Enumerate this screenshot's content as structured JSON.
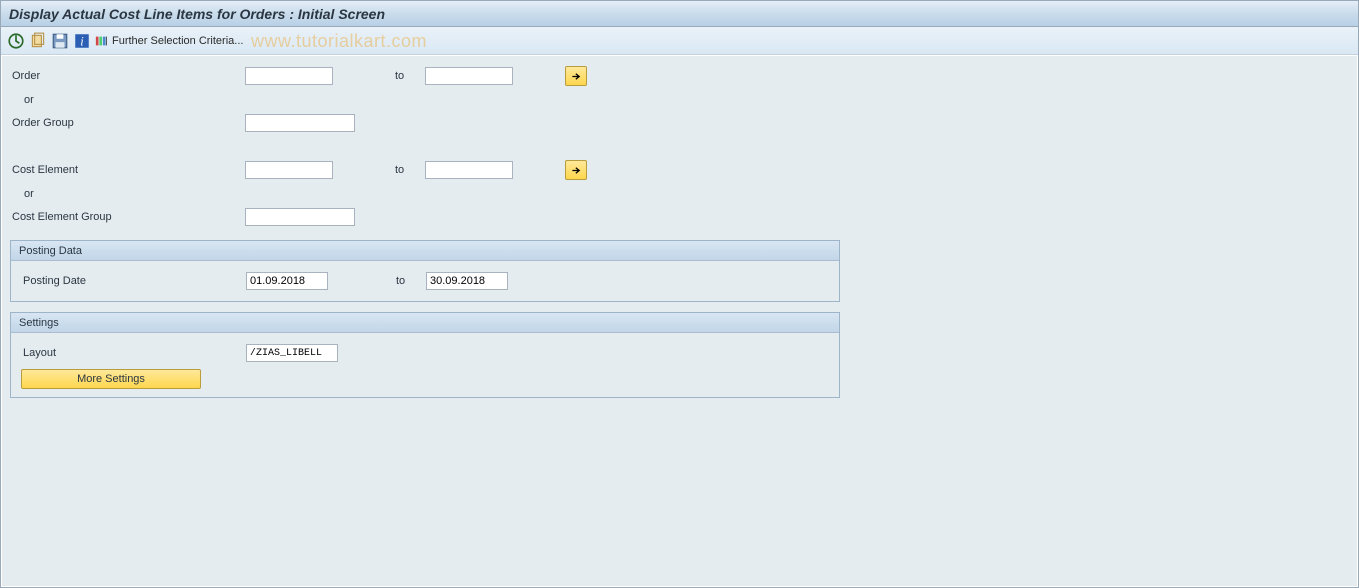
{
  "header": {
    "title": "Display Actual Cost Line Items for Orders : Initial Screen"
  },
  "toolbar": {
    "further_selection": "Further Selection Criteria..."
  },
  "watermark": "www.tutorialkart.com",
  "fields": {
    "order_label": "Order",
    "or1": "or",
    "order_group_label": "Order Group",
    "cost_element_label": "Cost Element",
    "or2": "or",
    "cost_element_group_label": "Cost Element Group",
    "to": "to",
    "order_from": "",
    "order_to": "",
    "order_group": "",
    "cost_element_from": "",
    "cost_element_to": "",
    "cost_element_group": ""
  },
  "posting": {
    "group_title": "Posting Data",
    "date_label": "Posting Date",
    "date_from": "01.09.2018",
    "date_to": "30.09.2018",
    "to": "to"
  },
  "settings": {
    "group_title": "Settings",
    "layout_label": "Layout",
    "layout_value": "/ZIAS_LIBELL",
    "more_button": "More Settings"
  }
}
